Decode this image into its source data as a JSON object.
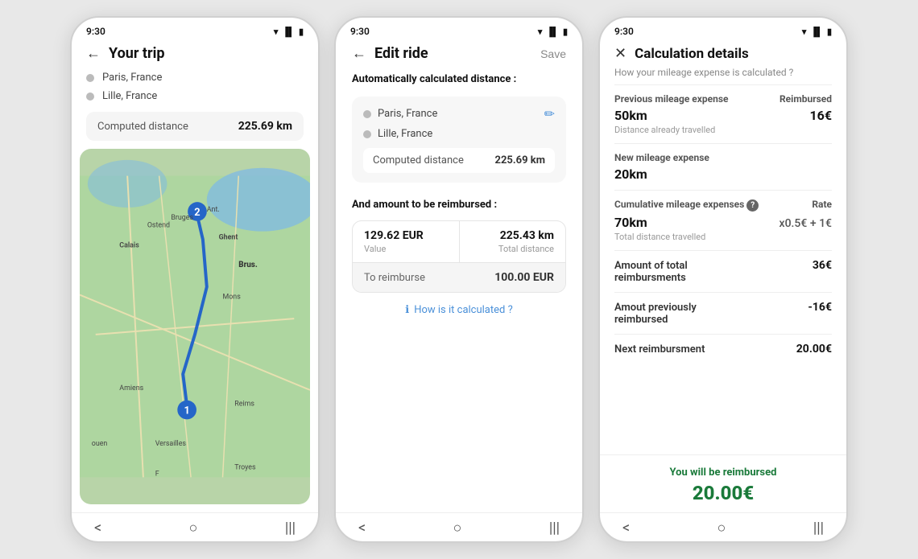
{
  "phone1": {
    "status_time": "9:30",
    "header_back": "←",
    "title": "Your trip",
    "waypoints": [
      {
        "label": "Paris, France"
      },
      {
        "label": "Lille, France"
      }
    ],
    "distance_label": "Computed distance",
    "distance_value": "225.69 km",
    "nav": {
      "back": "<",
      "home": "○",
      "menu": "|||"
    }
  },
  "phone2": {
    "status_time": "9:30",
    "header_back": "←",
    "title": "Edit ride",
    "save_label": "Save",
    "auto_distance_label": "Automatically calculated distance :",
    "waypoints": [
      {
        "label": "Paris, France",
        "editable": true
      },
      {
        "label": "Lille, France",
        "editable": false
      }
    ],
    "distance_label": "Computed distance",
    "distance_value": "225.69 km",
    "reimburse_label": "And amount to be reimbursed :",
    "value_label": "Value",
    "value_amount": "129.62 EUR",
    "total_distance_label": "Total distance",
    "total_distance_value": "225.43 km",
    "to_reimburse_label": "To reimburse",
    "to_reimburse_value": "100.00 EUR",
    "how_link": "How is it calculated ?",
    "nav": {
      "back": "<",
      "home": "○",
      "menu": "|||"
    }
  },
  "phone3": {
    "status_time": "9:30",
    "header_close": "✕",
    "title": "Calculation details",
    "subtitle": "How your mileage expense is calculated ?",
    "table": {
      "col1_header": "Previous mileage expense",
      "col2_header": "Reimbursed",
      "prev_distance": "50km",
      "prev_amount": "16€",
      "prev_sub": "Distance already travelled",
      "new_label": "New mileage expense",
      "new_value": "20km",
      "cumul_col1": "Cumulative mileage expenses",
      "cumul_col2": "Rate",
      "cumul_value": "70km",
      "cumul_rate": "x0.5€ + 1€",
      "cumul_sub": "Total distance travelled",
      "total_label": "Amount of total reimbursments",
      "total_value": "36€",
      "prev_reimb_label": "Amout previously reimbursed",
      "prev_reimb_value": "-16€",
      "next_label": "Next reimbursment",
      "next_value": "20.00€"
    },
    "footer_label": "You will be reimbursed",
    "footer_value": "20.00€",
    "nav": {
      "back": "<",
      "home": "○",
      "menu": "|||"
    }
  }
}
